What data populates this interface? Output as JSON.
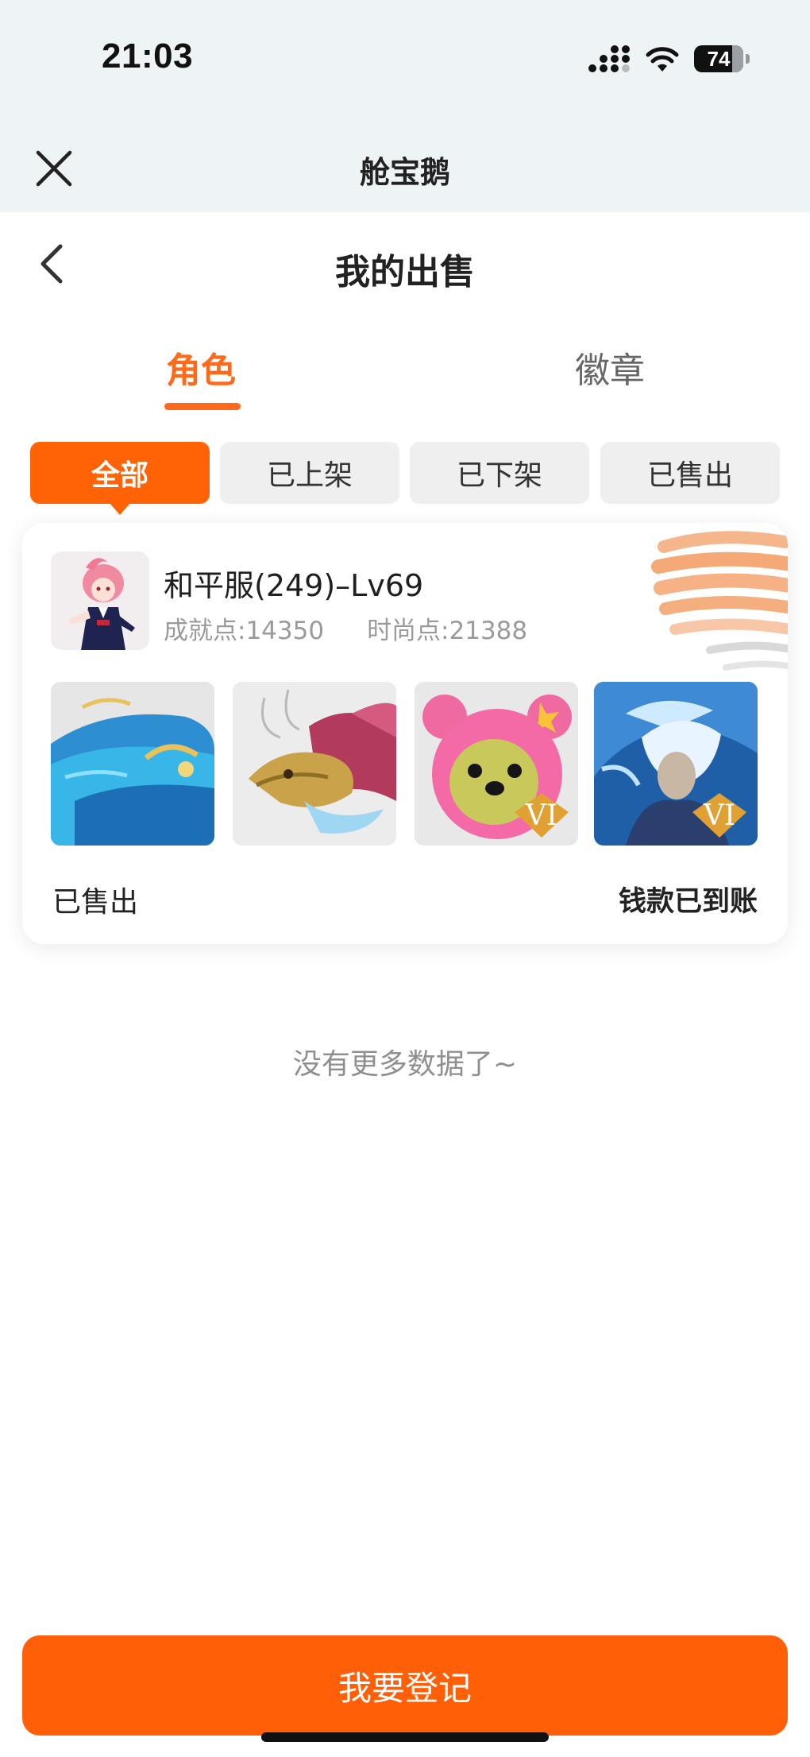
{
  "status_bar": {
    "time": "21:03",
    "battery": "74",
    "icons": [
      "signal-icon",
      "wifi-icon",
      "battery-icon"
    ]
  },
  "mini_program": {
    "title": "舱宝鹅",
    "close_icon": "close-icon"
  },
  "header": {
    "title": "我的出售",
    "back_icon": "chevron-left-icon"
  },
  "tabs": [
    {
      "label": "角色",
      "active": true
    },
    {
      "label": "徽章",
      "active": false
    }
  ],
  "filters": [
    {
      "label": "全部",
      "active": true
    },
    {
      "label": "已上架",
      "active": false
    },
    {
      "label": "已下架",
      "active": false
    },
    {
      "label": "已售出",
      "active": false
    }
  ],
  "listing": {
    "name": "和平服(249)–Lv69",
    "achievement": "成就点:14350",
    "fashion": "时尚点:21388",
    "thumbnails": [
      {
        "icon": "whale-mount-icon",
        "badge": ""
      },
      {
        "icon": "dragon-mount-icon",
        "badge": ""
      },
      {
        "icon": "pink-bear-icon",
        "badge": "VI"
      },
      {
        "icon": "ice-warrior-icon",
        "badge": "VI"
      }
    ],
    "status": "已售出",
    "payment_status": "钱款已到账"
  },
  "footer": {
    "no_more": "没有更多数据了~",
    "register_button": "我要登记"
  },
  "colors": {
    "accent": "#ff6306",
    "header_bg": "#eef3f6",
    "pill_bg": "#efefef",
    "muted_text": "#9a9a9a"
  }
}
